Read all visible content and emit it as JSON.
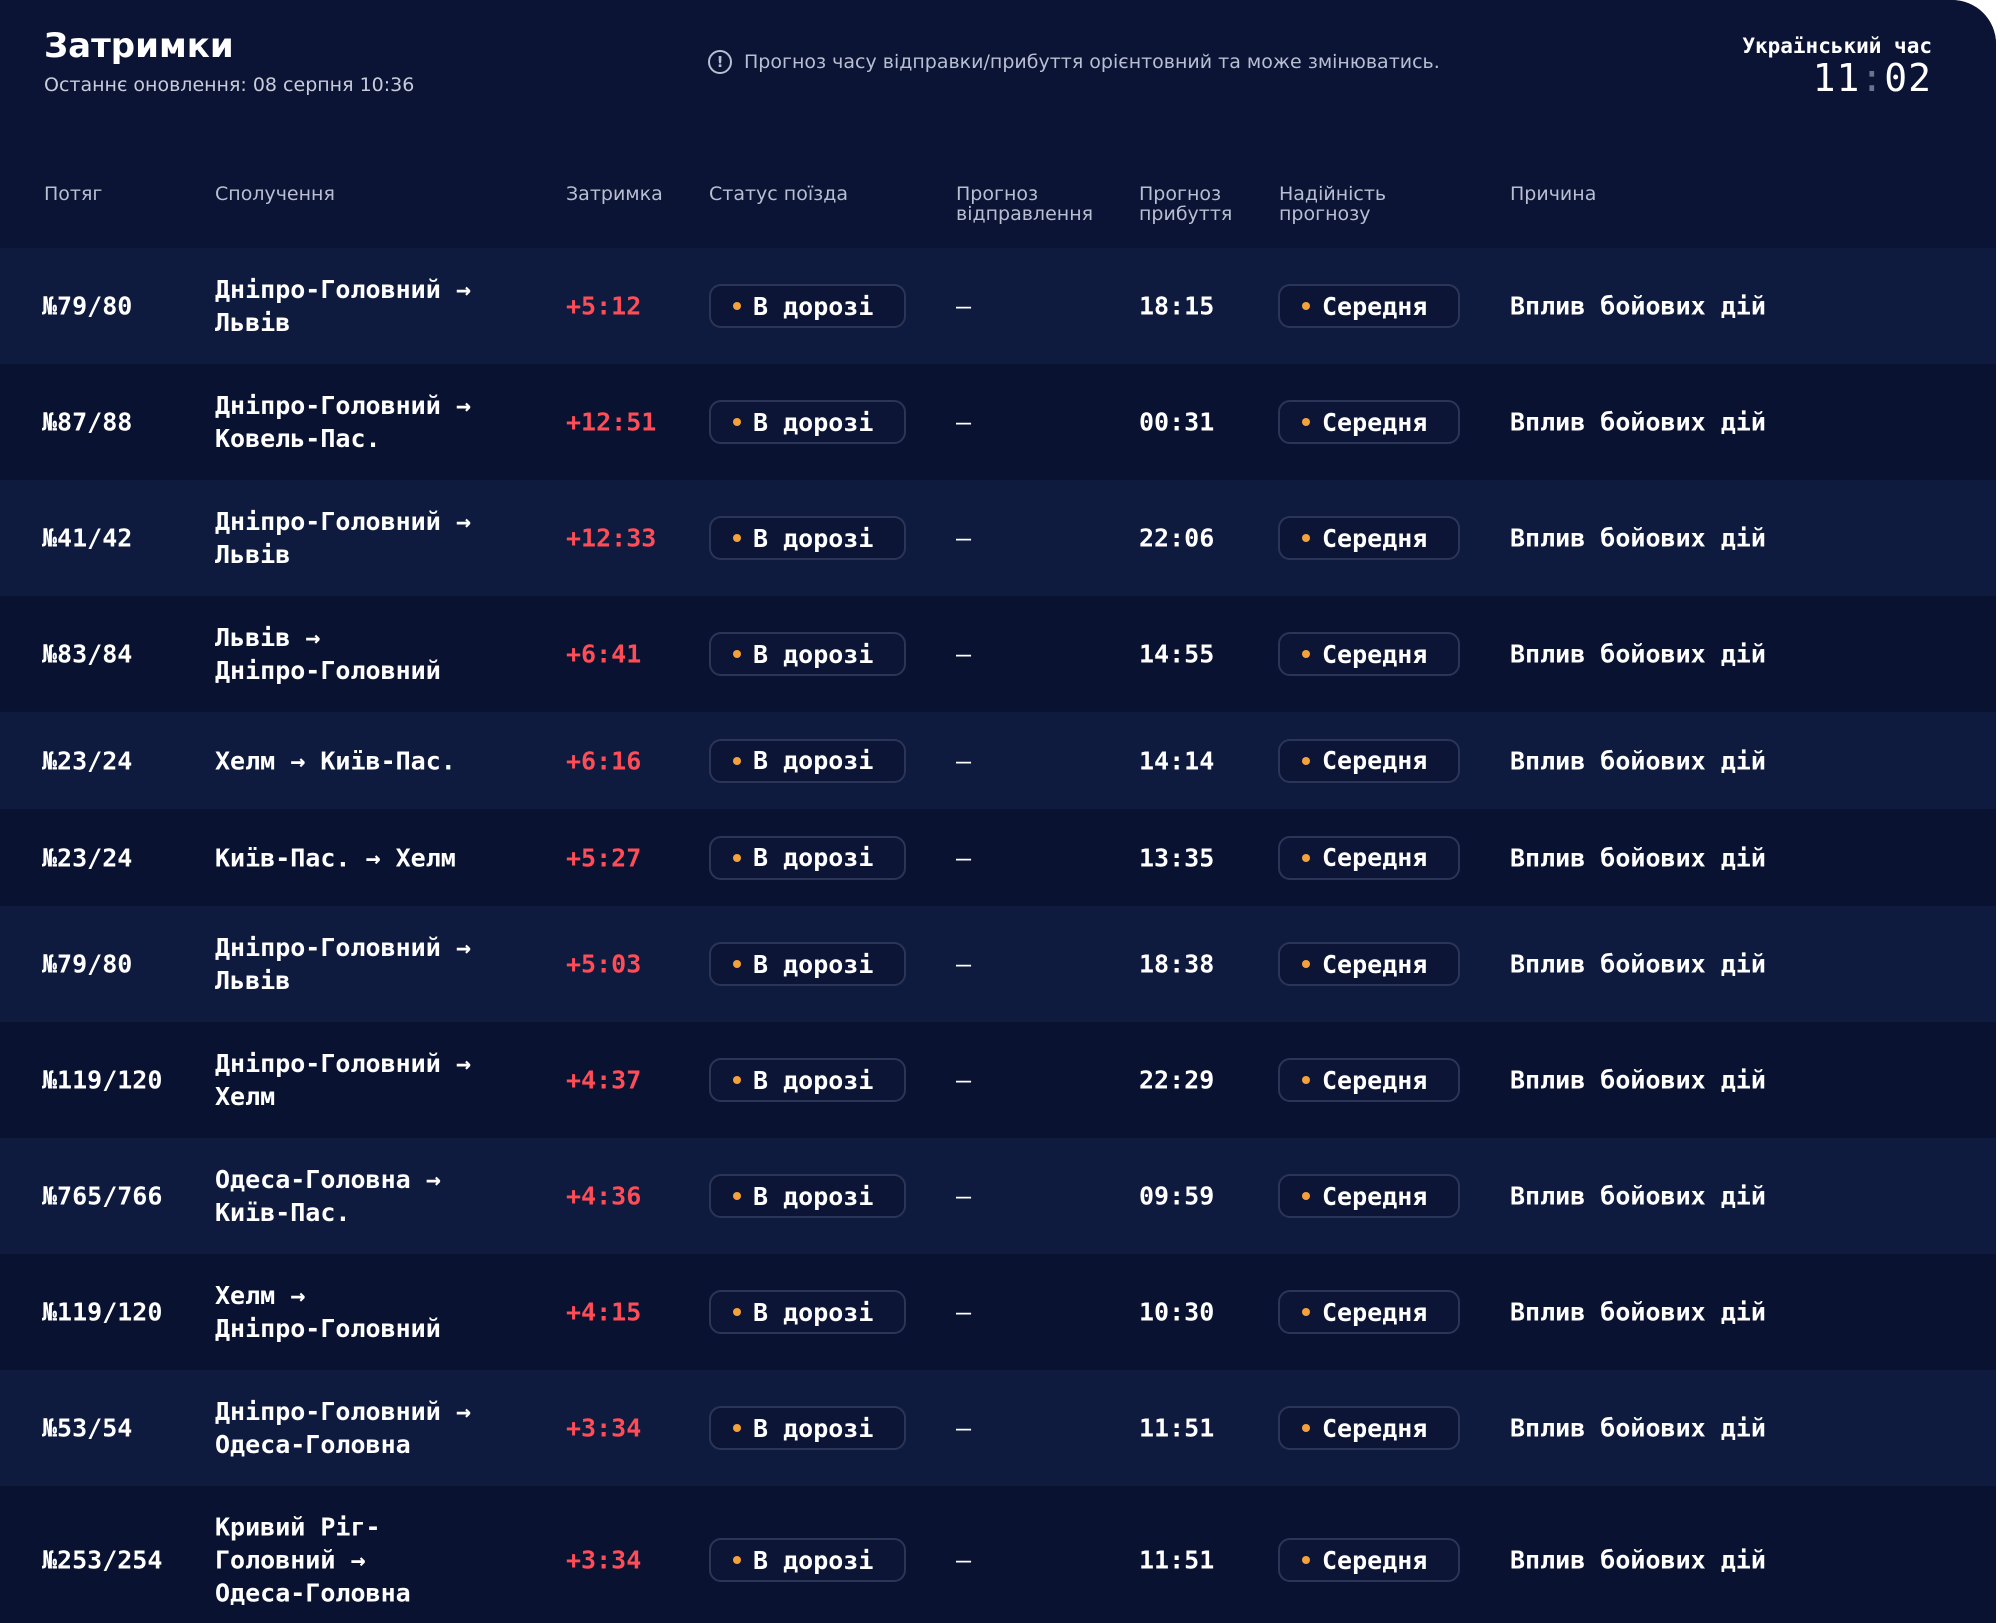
{
  "header": {
    "title": "Затримки",
    "last_update": "Останнє оновлення: 08 серпня 10:36",
    "notice": "Прогноз часу відправки/прибуття орієнтовний та може змінюватись.",
    "notice_icon": "info-icon",
    "clock_label": "Український час",
    "clock_hours": "11",
    "clock_sep": ":",
    "clock_minutes": "02"
  },
  "colors": {
    "background": "#0c1535",
    "delay": "#ff4d57",
    "status_dot": "#f5a13b"
  },
  "columns": {
    "train": "Потяг",
    "route": "Сполучення",
    "delay": "Затримка",
    "status": "Статус поїзда",
    "dep_forecast": "Прогноз відправлення",
    "arr_forecast": "Прогноз прибуття",
    "reliability": "Надійність прогнозу",
    "reason": "Причина"
  },
  "rows": [
    {
      "train": "№79/80",
      "route": "Дніпро-Головний →\nЛьвів",
      "delay": "+5:12",
      "status": "В дорозі",
      "dep": "—",
      "arr": "18:15",
      "reliability": "Середня",
      "reason": "Вплив бойових дій"
    },
    {
      "train": "№87/88",
      "route": "Дніпро-Головний →\nКовель-Пас.",
      "delay": "+12:51",
      "status": "В дорозі",
      "dep": "—",
      "arr": "00:31",
      "reliability": "Середня",
      "reason": "Вплив бойових дій"
    },
    {
      "train": "№41/42",
      "route": "Дніпро-Головний →\nЛьвів",
      "delay": "+12:33",
      "status": "В дорозі",
      "dep": "—",
      "arr": "22:06",
      "reliability": "Середня",
      "reason": "Вплив бойових дій"
    },
    {
      "train": "№83/84",
      "route": "Львів →\nДніпро-Головний",
      "delay": "+6:41",
      "status": "В дорозі",
      "dep": "—",
      "arr": "14:55",
      "reliability": "Середня",
      "reason": "Вплив бойових дій"
    },
    {
      "train": "№23/24",
      "route": "Хелм → Київ-Пас.",
      "delay": "+6:16",
      "status": "В дорозі",
      "dep": "—",
      "arr": "14:14",
      "reliability": "Середня",
      "reason": "Вплив бойових дій"
    },
    {
      "train": "№23/24",
      "route": "Київ-Пас. → Хелм",
      "delay": "+5:27",
      "status": "В дорозі",
      "dep": "—",
      "arr": "13:35",
      "reliability": "Середня",
      "reason": "Вплив бойових дій"
    },
    {
      "train": "№79/80",
      "route": "Дніпро-Головний →\nЛьвів",
      "delay": "+5:03",
      "status": "В дорозі",
      "dep": "—",
      "arr": "18:38",
      "reliability": "Середня",
      "reason": "Вплив бойових дій"
    },
    {
      "train": "№119/120",
      "route": "Дніпро-Головний →\nХелм",
      "delay": "+4:37",
      "status": "В дорозі",
      "dep": "—",
      "arr": "22:29",
      "reliability": "Середня",
      "reason": "Вплив бойових дій"
    },
    {
      "train": "№765/766",
      "route": "Одеса-Головна →\nКиїв-Пас.",
      "delay": "+4:36",
      "status": "В дорозі",
      "dep": "—",
      "arr": "09:59",
      "reliability": "Середня",
      "reason": "Вплив бойових дій"
    },
    {
      "train": "№119/120",
      "route": "Хелм →\nДніпро-Головний",
      "delay": "+4:15",
      "status": "В дорозі",
      "dep": "—",
      "arr": "10:30",
      "reliability": "Середня",
      "reason": "Вплив бойових дій"
    },
    {
      "train": "№53/54",
      "route": "Дніпро-Головний →\nОдеса-Головна",
      "delay": "+3:34",
      "status": "В дорозі",
      "dep": "—",
      "arr": "11:51",
      "reliability": "Середня",
      "reason": "Вплив бойових дій"
    },
    {
      "train": "№253/254",
      "route": "Кривий Ріг-\nГоловний →\nОдеса-Головна",
      "delay": "+3:34",
      "status": "В дорозі",
      "dep": "—",
      "arr": "11:51",
      "reliability": "Середня",
      "reason": "Вплив бойових дій"
    }
  ]
}
